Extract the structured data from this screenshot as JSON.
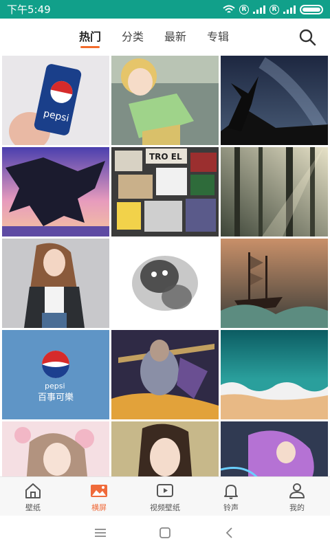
{
  "status_bar": {
    "time": "下午5:49",
    "indicator": "R"
  },
  "top_nav": {
    "tabs": [
      {
        "label": "热门",
        "active": true
      },
      {
        "label": "分类",
        "active": false
      },
      {
        "label": "最新",
        "active": false
      },
      {
        "label": "专辑",
        "active": false
      }
    ],
    "search_icon": "search-icon"
  },
  "wallpapers": [
    {
      "subject": "pepsi-can-in-hand",
      "overlay_text": "pepsi"
    },
    {
      "subject": "anime-girl-train"
    },
    {
      "subject": "milky-way-tree"
    },
    {
      "subject": "dragon-creature-sunset"
    },
    {
      "subject": "sticker-collage-poster",
      "overlay_text": "TRO EL"
    },
    {
      "subject": "misty-forest-sunbeams"
    },
    {
      "subject": "anime-girl-dark-jacket"
    },
    {
      "subject": "ink-wash-monster"
    },
    {
      "subject": "pirate-ship-storm"
    },
    {
      "subject": "pepsi-logo-blue",
      "overlay_text": "pepsi",
      "overlay_subtext": "百事可樂"
    },
    {
      "subject": "armored-game-hero"
    },
    {
      "subject": "aerial-beach-waves"
    },
    {
      "subject": "anime-girl-cherry-blossom"
    },
    {
      "subject": "portrait-young-woman"
    },
    {
      "subject": "purple-hair-anime-girl"
    }
  ],
  "bottom_nav": {
    "items": [
      {
        "label": "壁纸",
        "icon": "home-icon",
        "active": false
      },
      {
        "label": "横屏",
        "icon": "image-icon",
        "active": true
      },
      {
        "label": "视频壁纸",
        "icon": "video-icon",
        "active": false
      },
      {
        "label": "铃声",
        "icon": "bell-icon",
        "active": false
      },
      {
        "label": "我的",
        "icon": "user-icon",
        "active": false
      }
    ]
  },
  "colors": {
    "status_bar": "#11a08a",
    "accent": "#f26b2b",
    "active_nav": "#ef6a3a"
  }
}
